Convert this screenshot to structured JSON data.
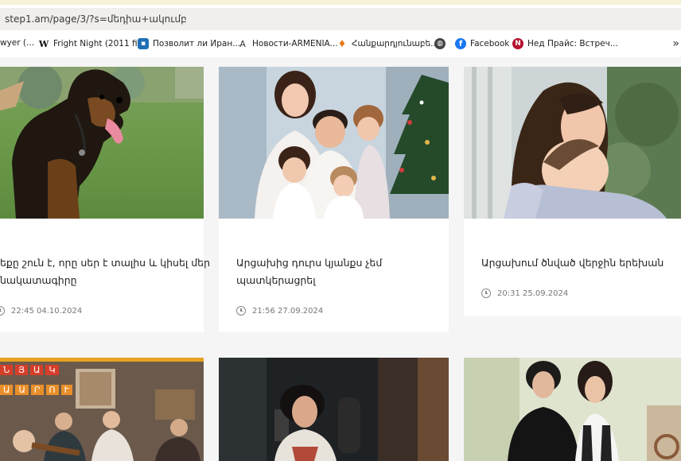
{
  "browser": {
    "url": "step1.am/page/3/?s=մեդիա+ակումբ",
    "bookmarks": [
      {
        "label": "wyer (...",
        "icon": "blank-icon",
        "color": "#ffffff"
      },
      {
        "label": "Fright Night (2011 fi...",
        "icon": "wikipedia-icon",
        "color": "#ffffff"
      },
      {
        "label": "Позволит ли Иран...",
        "icon": "news-icon",
        "color": "#1f6fb5"
      },
      {
        "label": "Новости-ARMENIA...",
        "icon": "armenia-icon",
        "color": "#ffffff"
      },
      {
        "label": "Հանքարդյունաբե...",
        "icon": "flame-icon",
        "color": "#ffffff"
      },
      {
        "label": "",
        "icon": "globe-icon",
        "color": "#444444"
      },
      {
        "label": "Facebook",
        "icon": "facebook-icon",
        "color": "#1877f2"
      },
      {
        "label": "Нед Прайс: Встреч...",
        "icon": "n-icon",
        "color": "#b3122e"
      }
    ],
    "overflow_icon": "»"
  },
  "articles": [
    {
      "title_lines": [
        "եքը շուն է, որը սեր է տալիս և կիսել մեր",
        "նակատագիրը"
      ],
      "time": "22:45 04.10.2024",
      "image": "dog-photo"
    },
    {
      "title_lines": [
        "Արցախից դուրս կյանքս չեմ",
        "պատկերացրել"
      ],
      "time": "21:56 27.09.2024",
      "image": "family-photo"
    },
    {
      "title_lines": [
        "Արցախում ծնված վերջին երեխան"
      ],
      "time": "20:31 25.09.2024",
      "image": "mother-child-photo"
    },
    {
      "title_lines": [],
      "time": "",
      "image": "band-photo",
      "image_text": [
        "ՆՅԱԿ",
        "ԱԱՐՈՒ"
      ]
    },
    {
      "title_lines": [],
      "time": "",
      "image": "woman-singer-photo"
    },
    {
      "title_lines": [],
      "time": "",
      "image": "two-women-photo"
    }
  ]
}
